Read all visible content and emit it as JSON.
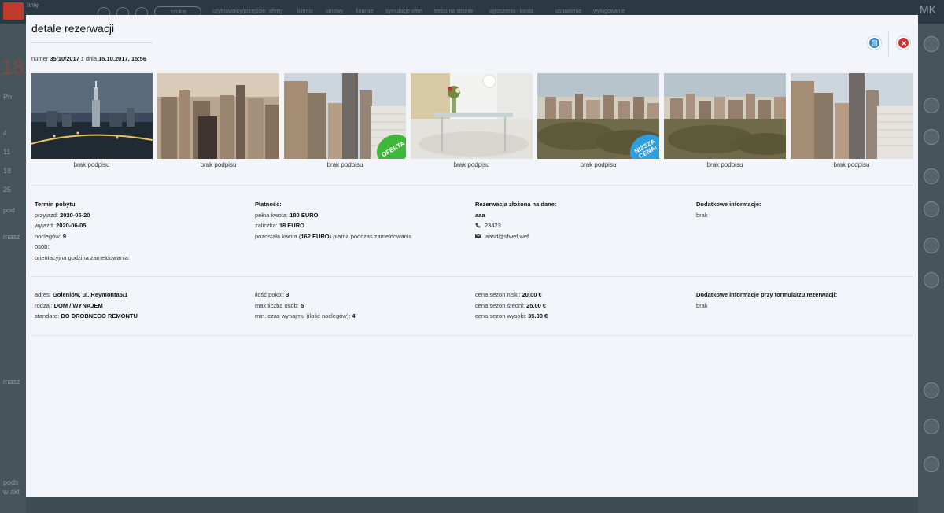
{
  "background": {
    "user_label": "Imię",
    "search_placeholder": "szukaj",
    "nav_items": [
      "użytkownicy/przejście",
      "oferty",
      "klienci",
      "umowy",
      "finanse",
      "symulacje ofert",
      "treści na stronie",
      "ogłoszenia i konta",
      "ustawienia",
      "wylogowanie"
    ],
    "logo_mark": "MK",
    "left_big_number": "18",
    "left_texts": [
      "Pn",
      "4",
      "11",
      "18",
      "25",
      "pod",
      "masz",
      "masz",
      "pods",
      "w akt"
    ]
  },
  "modal": {
    "title": "detale rezerwacji",
    "number_prefix": "numer",
    "number": "35/10/2017",
    "date_prefix": "z dnia",
    "date": "15.10.2017, 15:56",
    "edit_icon": "document-edit-icon",
    "close_icon": "close-icon"
  },
  "gallery": [
    {
      "caption": "brak podpisu",
      "badge": "",
      "scene": "night-city"
    },
    {
      "caption": "brak podpisu",
      "badge": "",
      "scene": "day-city"
    },
    {
      "caption": "brak podpisu",
      "badge": "OFERTA",
      "badge_color": "#3db83a",
      "scene": "skyscrapers"
    },
    {
      "caption": "brak podpisu",
      "badge": "",
      "scene": "interior"
    },
    {
      "caption": "brak podpisu",
      "badge": "NIŻSZA CENA!",
      "badge_color": "#2d9fe0",
      "scene": "park-city"
    },
    {
      "caption": "brak podpisu",
      "badge": "",
      "scene": "park-city"
    },
    {
      "caption": "brak podpisu",
      "badge": "",
      "scene": "skyscrapers"
    }
  ],
  "stay": {
    "heading": "Termin pobytu",
    "arrival_label": "przyjazd:",
    "arrival": "2020-05-20",
    "departure_label": "wyjazd:",
    "departure": "2020-06-05",
    "nights_label": "noclegów:",
    "nights": "9",
    "persons_label": "osób:",
    "persons": "",
    "checkin_label": "orientacyjna godzina zameldowania:",
    "checkin": ""
  },
  "payment": {
    "heading": "Płatność:",
    "total_label": "pełna kwota:",
    "total": "180 EURO",
    "deposit_label": "zaliczka:",
    "deposit": "18 EURO",
    "remaining_label": "pozostała kwota (",
    "remaining": "162 EURO",
    "remaining_suffix": ") płatna podczas zameldowania"
  },
  "customer": {
    "heading": "Rezerwacja złożona na dane:",
    "name": "aaa",
    "phone_icon": "phone-icon",
    "phone": "23423",
    "email_icon": "envelope-icon",
    "email": "aasd@sfwef.wef"
  },
  "extra": {
    "heading": "Dodatkowe informacje:",
    "value": "brak"
  },
  "property": {
    "address_label": "adres:",
    "address": "Goleniów, ul. Reymonta5/1",
    "type_label": "rodzaj:",
    "type": "DOM / WYNAJEM",
    "standard_label": "standard:",
    "standard": "DO DROBNEGO REMONTU",
    "rooms_label": "ilość pokoi:",
    "rooms": "3",
    "maxpersons_label": "max liczba osób:",
    "maxpersons": "5",
    "minrent_label": "min. czas wynajmu (ilość noclegów):",
    "minrent": "4",
    "price_low_label": "cena sezon niski:",
    "price_low": "20.00 €",
    "price_mid_label": "cena sezon średni:",
    "price_mid": "25.00 €",
    "price_high_label": "cena sezon wysoki:",
    "price_high": "35.00 €",
    "form_info_heading": "Dodatkowe informacje przy formularzu rezerwacji:",
    "form_info": "brak"
  }
}
